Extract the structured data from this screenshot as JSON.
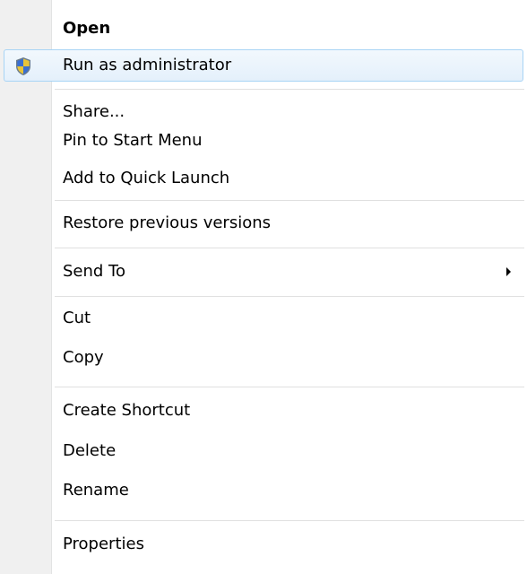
{
  "menu": {
    "items": [
      {
        "label": "Open",
        "bold": true
      },
      {
        "label": "Run as administrator",
        "icon": "uac-shield-icon",
        "highlighted": true
      },
      {
        "label": "Share..."
      },
      {
        "label": "Pin to Start Menu"
      },
      {
        "label": "Add to Quick Launch"
      },
      {
        "label": "Restore previous versions"
      },
      {
        "label": "Send To",
        "submenu": true
      },
      {
        "label": "Cut"
      },
      {
        "label": "Copy"
      },
      {
        "label": "Create Shortcut"
      },
      {
        "label": "Delete"
      },
      {
        "label": "Rename"
      },
      {
        "label": "Properties"
      }
    ]
  },
  "colors": {
    "highlight_border": "#a8d4f5",
    "highlight_fill": "#e4f0fb",
    "gutter": "#f0f0f0",
    "separator": "#e0e0e0"
  }
}
